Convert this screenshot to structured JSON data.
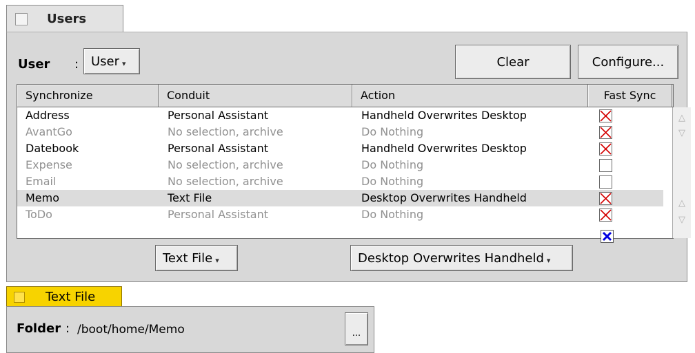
{
  "tabs": {
    "users": "Users",
    "text_file": "Text File"
  },
  "user_selector": {
    "label": "User",
    "colon": ":",
    "value": "User",
    "caret": "▾"
  },
  "buttons": {
    "clear": "Clear",
    "configure": "Configure..."
  },
  "table": {
    "headers": [
      "Synchronize",
      "Conduit",
      "Action",
      "Fast Sync"
    ],
    "rows": [
      {
        "name": "Address",
        "conduit": "Personal Assistant",
        "action": "Handheld Overwrites Desktop",
        "fast_sync": true,
        "enabled": true
      },
      {
        "name": "AvantGo",
        "conduit": "No selection, archive",
        "action": "Do Nothing",
        "fast_sync": true,
        "enabled": false
      },
      {
        "name": "Datebook",
        "conduit": "Personal Assistant",
        "action": "Handheld Overwrites Desktop",
        "fast_sync": true,
        "enabled": true
      },
      {
        "name": "Expense",
        "conduit": "No selection, archive",
        "action": "Do Nothing",
        "fast_sync": false,
        "enabled": false
      },
      {
        "name": "Email",
        "conduit": "No selection, archive",
        "action": "Do Nothing",
        "fast_sync": false,
        "enabled": false
      },
      {
        "name": "Memo",
        "conduit": "Text File",
        "action": "Desktop Overwrites Handheld",
        "fast_sync": true,
        "enabled": true,
        "selected": true
      },
      {
        "name": "ToDo",
        "conduit": "Personal Assistant",
        "action": "Do Nothing",
        "fast_sync": true,
        "enabled": false
      }
    ]
  },
  "selection_controls": {
    "conduit_menu": "Text File",
    "action_menu": "Desktop Overwrites Handheld",
    "fast_sync_checked": true
  },
  "scroll_arrows": {
    "up": "△",
    "down": "▽"
  },
  "folder": {
    "label": "Folder",
    "colon": ":",
    "path": "/boot/home/Memo",
    "browse_button": "..."
  },
  "colors": {
    "panel": "#d8d8d8",
    "text_file_tab": "#f7d300",
    "fast_sync_cross": "#d40000",
    "fast_sync_check": "#0000e0",
    "inactive_text": "#909090"
  }
}
